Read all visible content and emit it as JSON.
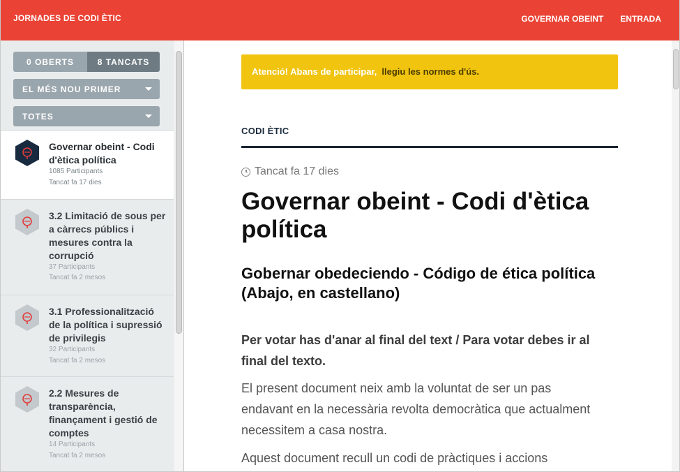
{
  "header": {
    "brand": "JORNADES DE CODI ÈTIC",
    "nav": [
      "GOVERNAR OBEINT",
      "ENTRADA"
    ],
    "color": "#ea4335"
  },
  "sidebar": {
    "filter_open": "0 OBERTS",
    "filter_closed": "8 TANCATS",
    "sort_select": "EL MÉS NOU PRIMER",
    "scope_select": "TOTES",
    "items": [
      {
        "title": "Governar obeint - Codi d'ètica política",
        "participants": "1085 Participants",
        "status": "Tancat fa 17 dies",
        "active": true
      },
      {
        "title": "3.2 Limitació de sous per a càrrecs públics i mesures contra la corrupció",
        "participants": "37 Participants",
        "status": "Tancat fa 2 mesos",
        "active": false
      },
      {
        "title": "3.1 Professionalització de la política i supressió de privilegis",
        "participants": "32 Participants",
        "status": "Tancat fa 2 mesos",
        "active": false
      },
      {
        "title": "2.2 Mesures de transparència, finançament i gestió de comptes",
        "participants": "14 Participants",
        "status": "Tancat fa 2 mesos",
        "active": false
      }
    ]
  },
  "main": {
    "notice_text": "Atenció! Abans de participar,",
    "notice_link": "llegiu les normes d'ús.",
    "notice_color": "#f1c40f",
    "category": "CODI ÈTIC",
    "closed": "Tancat fa 17 dies",
    "title": "Governar obeint - Codi d'ètica política",
    "subtitle": "Gobernar obedeciendo - Código de ética política (Abajo, en castellano)",
    "lead": "Per votar has d'anar al final del text / Para votar debes ir al final del texto.",
    "paragraph1": "El present document neix amb la voluntat de ser un pas endavant en la necessària revolta democràtica que actualment necessitem a casa nostra.",
    "paragraph2": "Aquest document recull un codi de pràctiques i accions"
  }
}
